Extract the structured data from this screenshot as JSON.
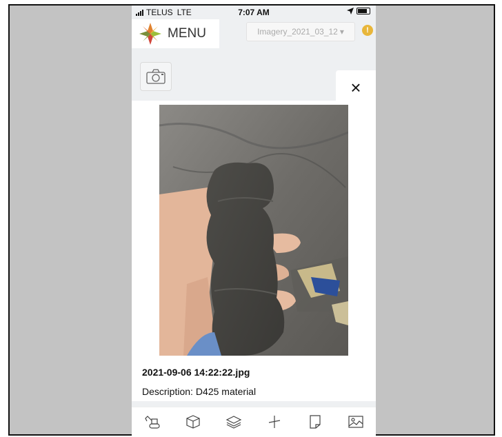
{
  "status_bar": {
    "carrier": "TELUS",
    "network": "LTE",
    "time": "7:07 AM"
  },
  "header": {
    "menu_label": "MENU",
    "imagery_select": {
      "value": "Imagery_2021_03_12",
      "caret": "▾"
    },
    "alert_symbol": "!"
  },
  "modal": {
    "close_symbol": "×",
    "photo": {
      "filename": "2021-09-06 14:22:22.jpg",
      "description_label": "Description:",
      "description_value": "D425 material"
    }
  },
  "toolbar": {
    "items": [
      {
        "name": "excavator-icon"
      },
      {
        "name": "cube-icon"
      },
      {
        "name": "layers-icon"
      },
      {
        "name": "measure-icon"
      },
      {
        "name": "note-icon"
      },
      {
        "name": "image-icon"
      }
    ]
  },
  "colors": {
    "alert": "#e8b63a",
    "background": "#eef0f2",
    "frame": "#c3c3c3"
  }
}
